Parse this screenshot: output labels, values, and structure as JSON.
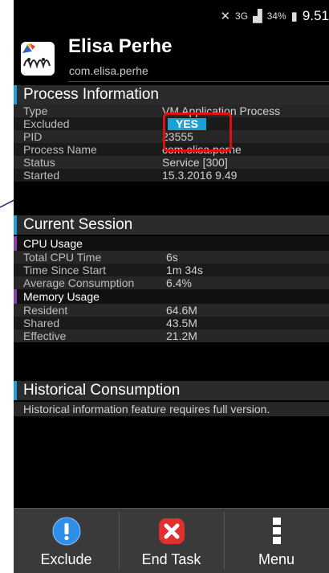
{
  "status_bar": {
    "network": "3G",
    "battery": "34%",
    "time": "9.51"
  },
  "app": {
    "name": "Elisa Perhe",
    "package": "com.elisa.perhe"
  },
  "process_information": {
    "title": "Process Information",
    "rows": [
      {
        "label": "Type",
        "value": "VM Application Process"
      },
      {
        "label": "Excluded",
        "value": "YES"
      },
      {
        "label": "PID",
        "value": "23555"
      },
      {
        "label": "Process Name",
        "value": "com.elisa.perhe"
      },
      {
        "label": "Status",
        "value": "Service [300]"
      },
      {
        "label": "Started",
        "value": "15.3.2016 9.49"
      }
    ]
  },
  "current_session": {
    "title": "Current Session",
    "cpu": {
      "title": "CPU Usage",
      "rows": [
        {
          "label": "Total CPU Time",
          "value": "6s"
        },
        {
          "label": "Time Since Start",
          "value": "1m 34s"
        },
        {
          "label": "Average Consumption",
          "value": "6.4%"
        }
      ]
    },
    "memory": {
      "title": "Memory Usage",
      "rows": [
        {
          "label": "Resident",
          "value": "64.6M"
        },
        {
          "label": "Shared",
          "value": "43.5M"
        },
        {
          "label": "Effective",
          "value": "21.2M"
        }
      ]
    }
  },
  "historical": {
    "title": "Historical Consumption",
    "text": "Historical information feature requires full version."
  },
  "bottom_bar": {
    "exclude": {
      "label": "Exclude",
      "icon": "info-exclamation-icon"
    },
    "end_task": {
      "label": "End Task",
      "icon": "close-x-icon"
    },
    "menu": {
      "label": "Menu",
      "icon": "overflow-menu-icon"
    }
  },
  "colors": {
    "accent": "#1aa0d8",
    "highlight": "#e01010",
    "subsection": "#8a3fb0"
  }
}
